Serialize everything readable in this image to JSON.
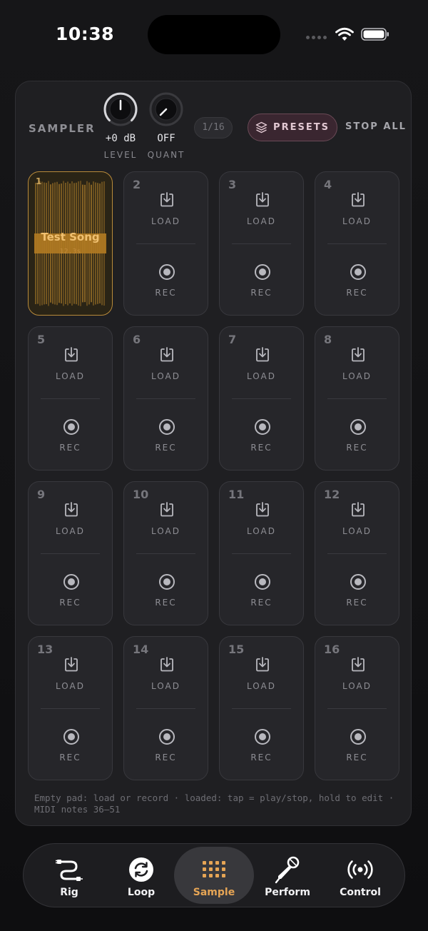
{
  "status_bar": {
    "time": "10:38"
  },
  "sampler": {
    "title": "SAMPLER",
    "level": {
      "value": "+0 dB",
      "label": "LEVEL"
    },
    "quant": {
      "value": "OFF",
      "label": "QUANT"
    },
    "counter": "1/16",
    "presets_label": "PRESETS",
    "stop_all_label": "STOP ALL",
    "load_label": "LOAD",
    "rec_label": "REC",
    "loaded_pad": {
      "number": "1",
      "name": "Test Song",
      "duration": "12.3s"
    },
    "pads": [
      "2",
      "3",
      "4",
      "5",
      "6",
      "7",
      "8",
      "9",
      "10",
      "11",
      "12",
      "13",
      "14",
      "15",
      "16"
    ],
    "hint": "Empty pad: load or record · loaded: tap = play/stop, hold to edit · MIDI notes 36–51"
  },
  "tabs": [
    {
      "label": "Rig",
      "icon": "cable-icon"
    },
    {
      "label": "Loop",
      "icon": "loop-icon"
    },
    {
      "label": "Sample",
      "icon": "grid-icon",
      "active": true
    },
    {
      "label": "Perform",
      "icon": "microphone-icon"
    },
    {
      "label": "Control",
      "icon": "broadcast-icon"
    }
  ],
  "colors": {
    "accent": "#e6a555",
    "pad_loaded_border": "#b88a3a",
    "presets_bg": "#3a2630"
  }
}
